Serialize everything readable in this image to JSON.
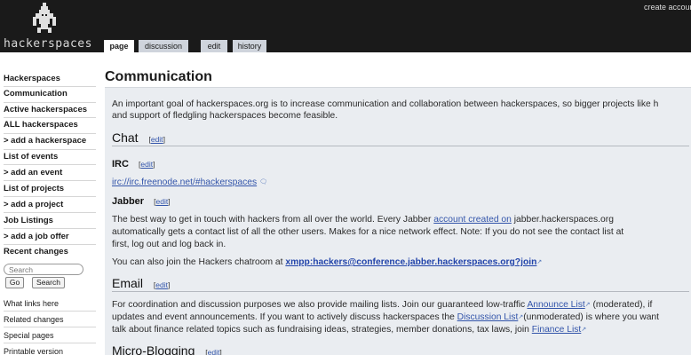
{
  "header": {
    "logo_text": "hackerspaces",
    "create_account": "create account",
    "tabs": [
      {
        "label": "page",
        "active": true
      },
      {
        "label": "discussion",
        "active": false
      },
      {
        "label": "edit",
        "active": false
      },
      {
        "label": "history",
        "active": false
      }
    ]
  },
  "sidebar": {
    "nav": [
      "Hackerspaces",
      "Communication",
      "Active hackerspaces",
      "ALL hackerspaces",
      "> add a hackerspace",
      "List of events",
      "> add an event",
      "List of projects",
      "> add a project",
      "Job Listings",
      "> add a job offer",
      "Recent changes"
    ],
    "search": {
      "placeholder": "Search",
      "go": "Go",
      "search_button": "Search"
    },
    "tools": [
      "What links here",
      "Related changes",
      "Special pages",
      "Printable version"
    ]
  },
  "main": {
    "title": "Communication",
    "intro": {
      "line1": "An important goal of hackerspaces.org is to increase communication and collaboration between hackerspaces, so bigger projects like h",
      "line2": "and support of fledgling hackerspaces become feasible."
    },
    "edit_link": "edit",
    "chat": {
      "heading": "Chat",
      "irc": {
        "heading": "IRC",
        "link": "irc://irc.freenode.net/#hackerspaces"
      },
      "jabber": {
        "heading": "Jabber",
        "p1a": "The best way to get in touch with hackers from all over the world. Every Jabber ",
        "p1_link": "account created on",
        "p1b": " jabber.hackerspaces.org",
        "p1_line2": "automatically gets a contact list of all the other users. Makes for a nice network effect. Note: If you do not see the contact list at",
        "p1_line3": "first, log out and log back in.",
        "p2a": "You can also join the Hackers chatroom at ",
        "p2_link": "xmpp:hackers@conference.jabber.hackerspaces.org?join"
      }
    },
    "email": {
      "heading": "Email",
      "l1a": "For coordination and discussion purposes we also provide mailing lists. Join our guaranteed low-traffic ",
      "l1_link": "Announce List",
      "l1b": " (moderated), if",
      "l2a": "updates and event announcements. If you want to actively discuss hackerspaces the ",
      "l2_link": "Discussion List",
      "l2b": "(unmoderated) is where you want",
      "l3a": "talk about finance related topics such as fundraising ideas, strategies, member donations, tax laws, join ",
      "l3_link": "Finance List"
    },
    "micro": {
      "heading": "Micro-Blogging"
    }
  }
}
